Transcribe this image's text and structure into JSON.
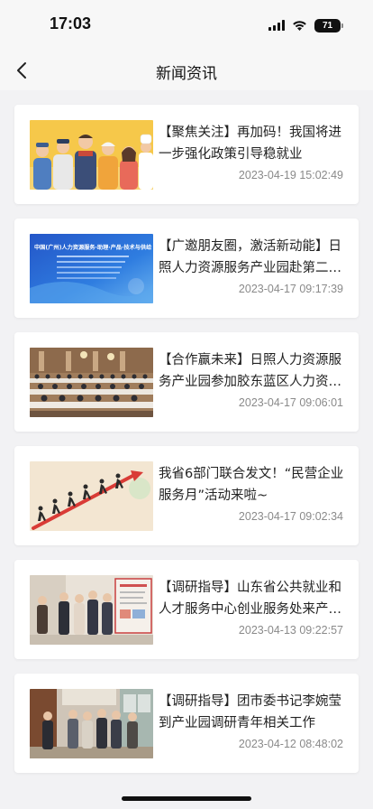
{
  "status_bar": {
    "time": "17:03",
    "battery": "71"
  },
  "nav": {
    "back_icon": "chevron-left-icon",
    "title": "新闻资讯"
  },
  "news": [
    {
      "title": "【聚焦关注】再加码！我国将进一步强化政策引导稳就业",
      "date": "2023-04-19 15:02:49",
      "image": "workers-illustration"
    },
    {
      "title": "【广邀朋友圈，激活新动能】日照人力资源服务产业园赴第二十一届中国(广州)人力资源服务博览会",
      "date": "2023-04-17 09:17:39",
      "image": "expo-banner",
      "image_text": "中国(广州)人力资源服务·助理·产品·技术与供给"
    },
    {
      "title": "【合作赢未来】日照人力资源服务产业园参加胶东蓝区人力资源服务产业联盟会议",
      "date": "2023-04-17 09:06:01",
      "image": "conference-hall"
    },
    {
      "title": "我省6部门联合发文！“民营企业服务月”活动来啦~",
      "date": "2023-04-17 09:02:34",
      "image": "runners-illustration"
    },
    {
      "title": "【调研指导】山东省公共就业和人才服务中心创业服务处来产业园调研指导",
      "date": "2023-04-13 09:22:57",
      "image": "visit-photo"
    },
    {
      "title": "【调研指导】团市委书记李婉莹到产业园调研青年相关工作",
      "date": "2023-04-12 08:48:02",
      "image": "office-visit-photo"
    }
  ]
}
